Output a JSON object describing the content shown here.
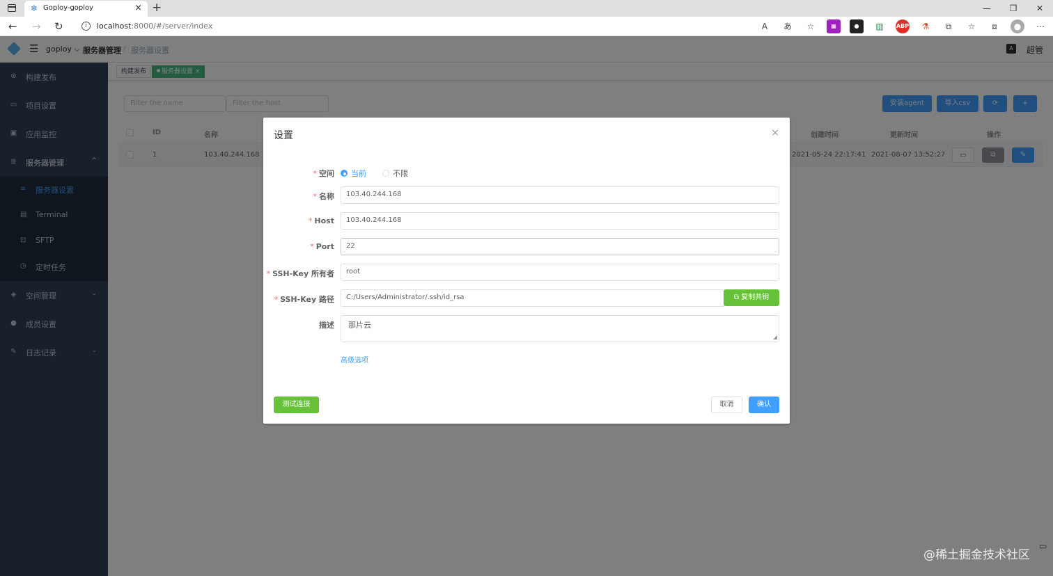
{
  "browser": {
    "tab_title": "Goploy-goploy",
    "url_host": "localhost",
    "url_rest": ":8000/#/server/index",
    "win_min": "—",
    "win_max": "❐",
    "win_close": "✕"
  },
  "header": {
    "namespace": "goploy ⌵",
    "breadcrumb_1": "服务器管理",
    "breadcrumb_sep": "/",
    "breadcrumb_2": "服务器设置",
    "lang_icon": "A",
    "user": "超管"
  },
  "sidebar": {
    "items": [
      {
        "label": "构建发布",
        "icon": "rocket-icon"
      },
      {
        "label": "项目设置",
        "icon": "folder-icon"
      },
      {
        "label": "应用监控",
        "icon": "monitor-icon"
      },
      {
        "label": "服务器管理",
        "icon": "server-icon",
        "arrow": "^"
      },
      {
        "label": "空间管理",
        "icon": "cube-icon",
        "arrow": "⌄"
      },
      {
        "label": "成员设置",
        "icon": "user-icon"
      },
      {
        "label": "日志记录",
        "icon": "log-icon",
        "arrow": "⌄"
      }
    ],
    "sub_items": [
      {
        "label": "服务器设置",
        "active": true
      },
      {
        "label": "Terminal"
      },
      {
        "label": "SFTP"
      },
      {
        "label": "定时任务"
      }
    ]
  },
  "tags": {
    "tag_1": "构建发布",
    "tag_2": "服务器设置",
    "tag_2_close": "×"
  },
  "filters": {
    "name_placeholder": "Filter the name",
    "host_placeholder": "Filter the host"
  },
  "toolbar": {
    "install_agent": "安装agent",
    "import_csv": "导入csv",
    "refresh": "⟳",
    "add": "+"
  },
  "table": {
    "headers": {
      "id": "ID",
      "name": "名称",
      "created": "创建时间",
      "updated": "更新时间",
      "ops": "操作"
    },
    "rows": [
      {
        "id": "1",
        "name": "103.40.244.168",
        "created": "2021-05-24 22:17:41",
        "updated": "2021-08-07 13:52:27"
      }
    ]
  },
  "dialog": {
    "title": "设置",
    "close": "×",
    "space_label": "空间",
    "space_options": [
      "当前",
      "不限"
    ],
    "name_label": "名称",
    "name_value": "103.40.244.168",
    "host_label": "Host",
    "host_value": "103.40.244.168",
    "port_label": "Port",
    "port_value": "22",
    "owner_label": "SSH-Key 所有者",
    "owner_value": "root",
    "path_label": "SSH-Key 路径",
    "path_value": "C:/Users/Administrator/.ssh/id_rsa",
    "copy_button": "复制共钥",
    "desc_label": "描述",
    "desc_value": "那片云",
    "advanced_link": "高级选项",
    "test_button": "测试连接",
    "cancel_button": "取消",
    "confirm_button": "确认"
  },
  "watermark": "@稀土掘金技术社区"
}
